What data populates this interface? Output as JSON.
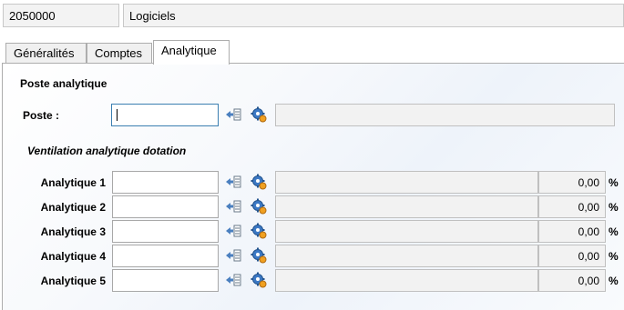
{
  "header": {
    "code": "2050000",
    "name": "Logiciels"
  },
  "tabs": [
    {
      "label": "Généralités",
      "active": false
    },
    {
      "label": "Comptes",
      "active": false
    },
    {
      "label": "Analytique",
      "active": true
    }
  ],
  "poste": {
    "section_title": "Poste analytique",
    "label": "Poste :",
    "value": "",
    "description": ""
  },
  "ventilation": {
    "section_title": "Ventilation analytique dotation",
    "percent_sign": "%",
    "rows": [
      {
        "label": "Analytique 1",
        "value": "",
        "description": "",
        "percent": "0,00"
      },
      {
        "label": "Analytique 2",
        "value": "",
        "description": "",
        "percent": "0,00"
      },
      {
        "label": "Analytique 3",
        "value": "",
        "description": "",
        "percent": "0,00"
      },
      {
        "label": "Analytique 4",
        "value": "",
        "description": "",
        "percent": "0,00"
      },
      {
        "label": "Analytique 5",
        "value": "",
        "description": "",
        "percent": "0,00"
      }
    ]
  },
  "icons": {
    "lookup": "list-lookup-icon",
    "settings": "gear-settings-icon"
  },
  "colors": {
    "panel_bg": "#eef3fa",
    "focus_border": "#3c7fb1",
    "field_bg": "#f2f2f2"
  }
}
